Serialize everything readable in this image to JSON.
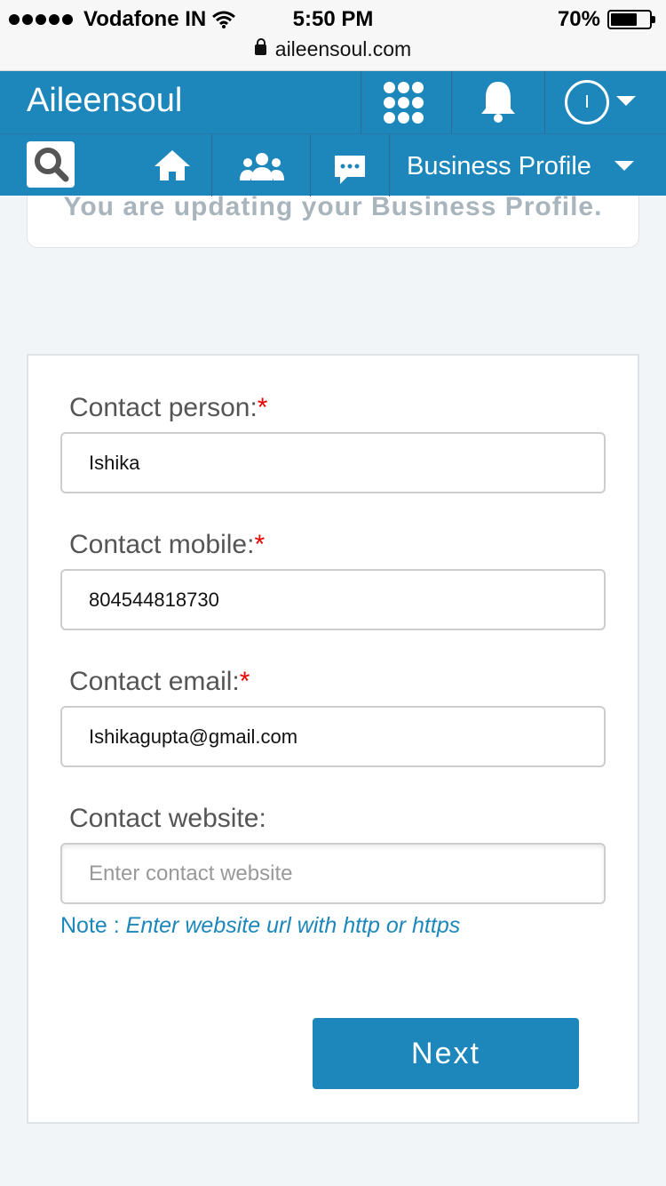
{
  "status_bar": {
    "carrier": "Vodafone IN",
    "time": "5:50 PM",
    "battery": "70%",
    "battery_level": 0.7,
    "url": "aileensoul.com"
  },
  "header": {
    "brand": "Aileensoul",
    "avatar_initial": "I",
    "icons": [
      "grid-icon",
      "bell-icon",
      "avatar",
      "chevron-down-icon"
    ]
  },
  "nav": {
    "icons": [
      "search-icon",
      "home-icon",
      "people-icon",
      "chat-icon"
    ],
    "current_profile": "Business Profile"
  },
  "notice": {
    "text": "You are updating your Business Profile."
  },
  "form": {
    "person": {
      "label": "Contact person:",
      "required_mark": "*",
      "value": "Ishika"
    },
    "mobile": {
      "label": "Contact mobile:",
      "required_mark": "*",
      "value": "804544818730"
    },
    "email": {
      "label": "Contact email:",
      "required_mark": "*",
      "value": "Ishikagupta@gmail.com"
    },
    "website": {
      "label": "Contact website:",
      "placeholder": "Enter contact website",
      "value": ""
    },
    "note_prefix": "Note : ",
    "note_text": "Enter website url with http or https",
    "next_label": "Next"
  },
  "colors": {
    "brand_blue": "#1d87bb",
    "required_red": "#ee0000",
    "page_bg": "#f2f5f8"
  }
}
